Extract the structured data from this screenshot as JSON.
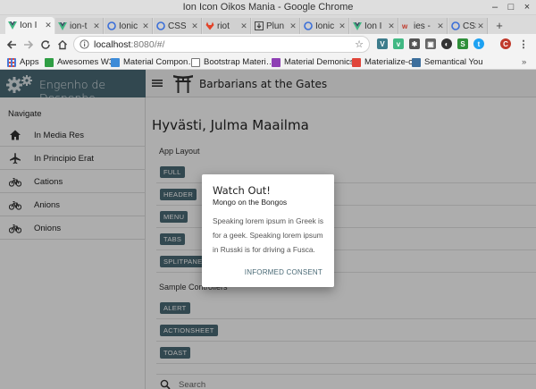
{
  "window": {
    "title": "Ion Icon Oikos Mania - Google Chrome"
  },
  "tabs": [
    {
      "label": "Ion I",
      "icon": "vue-icon",
      "active": true
    },
    {
      "label": "ion-t",
      "icon": "vue-icon"
    },
    {
      "label": "Ionic",
      "icon": "globe-icon"
    },
    {
      "label": "CSS",
      "icon": "globe-icon"
    },
    {
      "label": "riot",
      "icon": "gitlab-icon"
    },
    {
      "label": "Plun",
      "icon": "download-icon"
    },
    {
      "label": "Ionic",
      "icon": "globe-icon"
    },
    {
      "label": "Ion I",
      "icon": "vue-icon"
    },
    {
      "label": "ies -",
      "icon": "w3-icon"
    },
    {
      "label": "CSS",
      "icon": "globe-icon"
    }
  ],
  "toolbar": {
    "url_host": "localhost",
    "url_rest": ":8080/#/",
    "profile_letter": "C"
  },
  "bookmarks": [
    {
      "label": "Apps",
      "color": "#4a7ad8"
    },
    {
      "label": "Awesomes W3",
      "color": "#2f9e44"
    },
    {
      "label": "Material Compon…",
      "color": "#3d8bd8"
    },
    {
      "label": "Bootstrap Materi…",
      "color": "#777777"
    },
    {
      "label": "Material Demonics",
      "color": "#8e3fb4"
    },
    {
      "label": "Materialize-o",
      "color": "#e0453a"
    },
    {
      "label": "Semantical You",
      "color": "#3d6f9c"
    }
  ],
  "app": {
    "title": "Engenho de Despenho",
    "page_title": "Barbarians at the Gates",
    "brand_color": "#4a6a76"
  },
  "sidebar": {
    "heading": "Navigate",
    "items": [
      {
        "label": "In Media Res",
        "icon": "home-icon"
      },
      {
        "label": "In Principio Erat",
        "icon": "airplane-icon"
      },
      {
        "label": "Cations",
        "icon": "bicycle-icon"
      },
      {
        "label": "Anions",
        "icon": "bicycle-icon"
      },
      {
        "label": "Onions",
        "icon": "bicycle-icon"
      }
    ]
  },
  "content": {
    "heading": "Hyvästi, Julma Maailma",
    "sections": [
      {
        "title": "App Layout",
        "buttons": [
          "FULL",
          "HEADER",
          "MENU",
          "TABS",
          "SPLITPANE"
        ]
      },
      {
        "title": "Sample Controllers",
        "buttons": [
          "ALERT",
          "ACTIONSHEET",
          "TOAST"
        ]
      }
    ],
    "search_placeholder": "Search"
  },
  "alert": {
    "header": "Watch Out!",
    "subheader": "Mongo on the Bongos",
    "message": "Speaking lorem ipsum in Greek is for a geek. Speaking lorem ipsum in Russki is for driving a Fusca.",
    "button": "INFORMED CONSENT"
  }
}
